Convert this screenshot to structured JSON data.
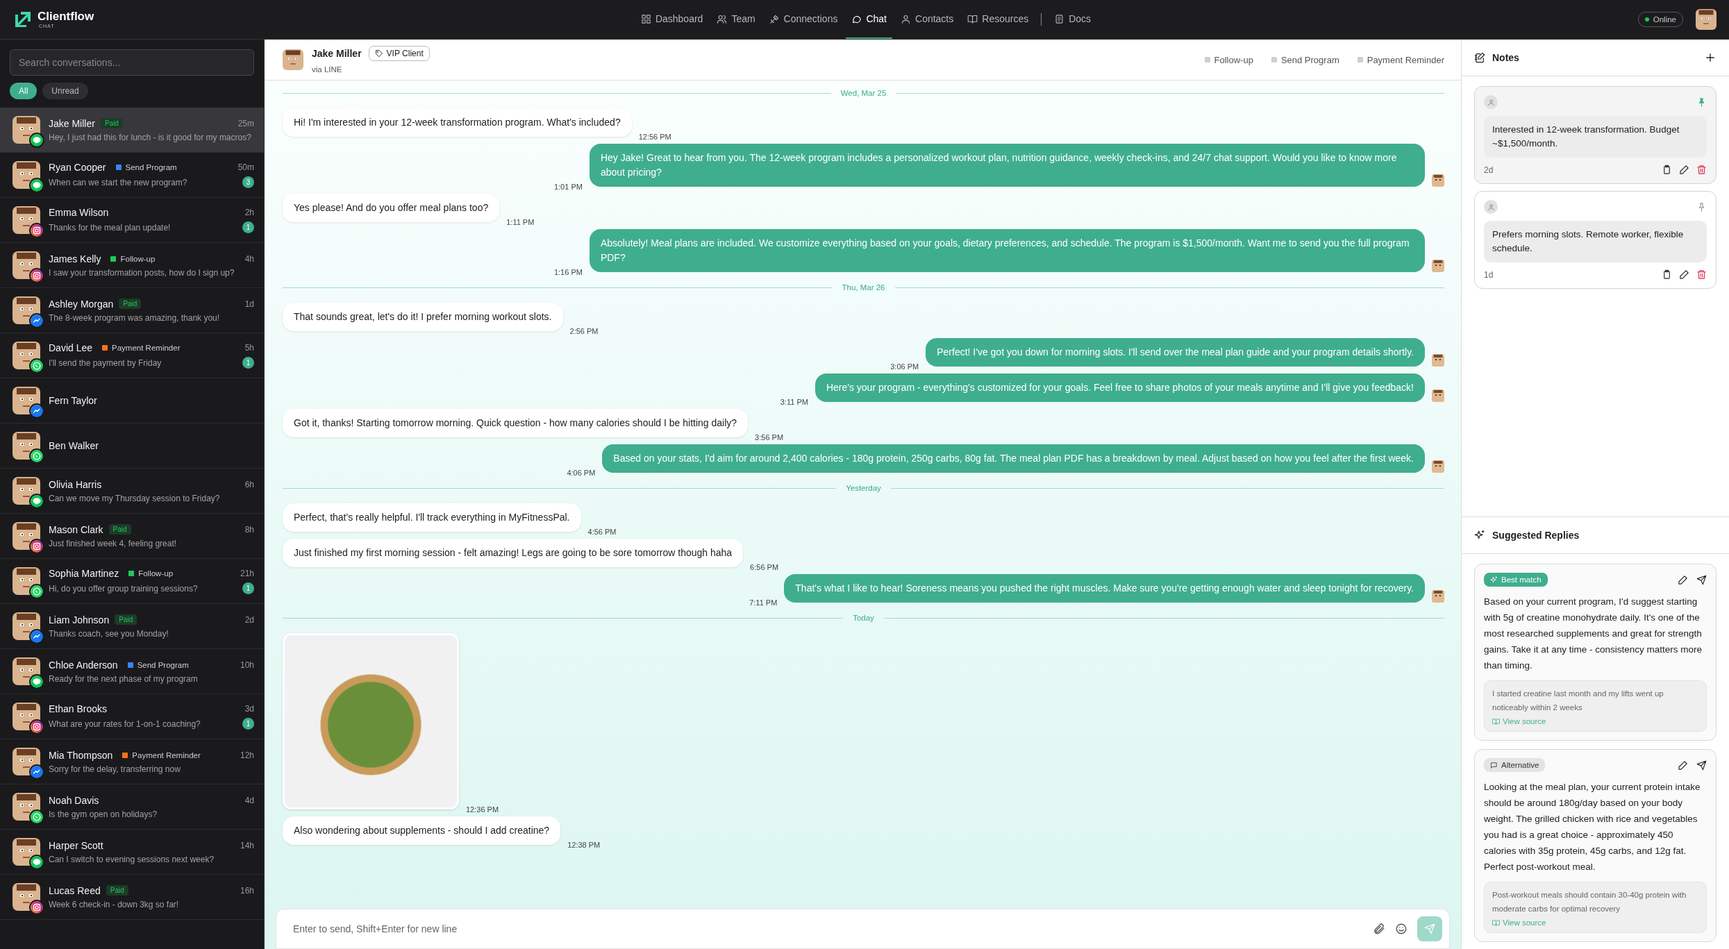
{
  "app": {
    "logo": "Clientflow",
    "logo_sub": "CHAT"
  },
  "nav": [
    {
      "label": "Dashboard",
      "selected": false,
      "separated": false
    },
    {
      "label": "Team",
      "selected": false,
      "separated": false
    },
    {
      "label": "Connections",
      "selected": false,
      "separated": false
    },
    {
      "label": "Chat",
      "selected": true,
      "separated": false
    },
    {
      "label": "Contacts",
      "selected": false,
      "separated": false
    },
    {
      "label": "Resources",
      "selected": false,
      "separated": false
    },
    {
      "label": "Docs",
      "selected": false,
      "separated": true
    }
  ],
  "status": {
    "label": "Online",
    "online": true
  },
  "sidebar": {
    "search": {
      "placeholder": "Search conversations..."
    },
    "filters": [
      {
        "label": "All",
        "selected": true
      },
      {
        "label": "Unread",
        "selected": false
      }
    ],
    "conversations": [
      {
        "name": "Jake Miller",
        "tag": {
          "kind": "paid",
          "text": "Paid"
        },
        "time": "25m",
        "preview": "Hey, I just had this for lunch - is it good for my macros?",
        "kind": "line",
        "selected": true
      },
      {
        "name": "Ryan Cooper",
        "tag": {
          "kind": "label",
          "text": "Send Program",
          "color": "#3b82f6"
        },
        "time": "50m",
        "preview": "When can we start the new program?",
        "unread": "3",
        "kind": "line",
        "selected": false
      },
      {
        "name": "Emma Wilson",
        "time": "2h",
        "preview": "Thanks for the meal plan update!",
        "unread": "1",
        "kind": "instagram",
        "selected": false
      },
      {
        "name": "James Kelly",
        "tag": {
          "kind": "label",
          "text": "Follow-up",
          "color": "#22c55e"
        },
        "time": "4h",
        "preview": "I saw your transformation posts, how do I sign up?",
        "kind": "instagram",
        "selected": false
      },
      {
        "name": "Ashley Morgan",
        "tag": {
          "kind": "paid",
          "text": "Paid"
        },
        "time": "1d",
        "preview": "The 8-week program was amazing, thank you!",
        "kind": "messenger",
        "selected": false
      },
      {
        "name": "David Lee",
        "tag": {
          "kind": "label",
          "text": "Payment Reminder",
          "color": "#f97316"
        },
        "time": "5h",
        "preview": "I'll send the payment by Friday",
        "unread": "1",
        "kind": "whatsapp",
        "selected": false
      },
      {
        "name": "Fern Taylor",
        "kind": "messenger",
        "selected": false
      },
      {
        "name": "Ben Walker",
        "kind": "whatsapp",
        "selected": false
      },
      {
        "name": "Olivia Harris",
        "time": "6h",
        "preview": "Can we move my Thursday session to Friday?",
        "kind": "line",
        "selected": false
      },
      {
        "name": "Mason Clark",
        "tag": {
          "kind": "paid",
          "text": "Paid"
        },
        "time": "8h",
        "preview": "Just finished week 4, feeling great!",
        "kind": "instagram",
        "selected": false
      },
      {
        "name": "Sophia Martinez",
        "tag": {
          "kind": "label",
          "text": "Follow-up",
          "color": "#22c55e"
        },
        "time": "21h",
        "preview": "Hi, do you offer group training sessions?",
        "unread": "1",
        "kind": "whatsapp",
        "selected": false
      },
      {
        "name": "Liam Johnson",
        "tag": {
          "kind": "paid",
          "text": "Paid"
        },
        "time": "2d",
        "preview": "Thanks coach, see you Monday!",
        "kind": "messenger",
        "selected": false
      },
      {
        "name": "Chloe Anderson",
        "tag": {
          "kind": "label",
          "text": "Send Program",
          "color": "#3b82f6"
        },
        "time": "10h",
        "preview": "Ready for the next phase of my program",
        "kind": "line",
        "selected": false
      },
      {
        "name": "Ethan Brooks",
        "time": "3d",
        "preview": "What are your rates for 1-on-1 coaching?",
        "unread": "1",
        "kind": "instagram",
        "selected": false
      },
      {
        "name": "Mia Thompson",
        "tag": {
          "kind": "label",
          "text": "Payment Reminder",
          "color": "#f97316"
        },
        "time": "12h",
        "preview": "Sorry for the delay, transferring now",
        "kind": "messenger",
        "selected": false
      },
      {
        "name": "Noah Davis",
        "time": "4d",
        "preview": "Is the gym open on holidays?",
        "kind": "whatsapp",
        "selected": false
      },
      {
        "name": "Harper Scott",
        "time": "14h",
        "preview": "Can I switch to evening sessions next week?",
        "kind": "line",
        "selected": false
      },
      {
        "name": "Lucas Reed",
        "tag": {
          "kind": "paid",
          "text": "Paid"
        },
        "time": "16h",
        "preview": "Week 6 check-in - down 3kg so far!",
        "kind": "instagram",
        "selected": false
      }
    ]
  },
  "chat": {
    "header": {
      "name": "Jake Miller",
      "tag": "VIP Client",
      "via": "via LINE",
      "quick_labels": [
        "Follow-up",
        "Send Program",
        "Payment Reminder"
      ]
    },
    "messages": [
      {
        "kind": "date",
        "text": "Wed, Mar 25"
      },
      {
        "kind": "in",
        "text": "Hi! I'm interested in your 12-week transformation program. What's included?",
        "time": "12:56 PM"
      },
      {
        "kind": "out",
        "text": "Hey Jake! Great to hear from you. The 12-week program includes a personalized workout plan, nutrition guidance, weekly check-ins, and 24/7 chat support. Would you like to know more about pricing?",
        "time": "1:01 PM"
      },
      {
        "kind": "in",
        "text": "Yes please! And do you offer meal plans too?",
        "time": "1:11 PM"
      },
      {
        "kind": "out",
        "text": "Absolutely! Meal plans are included. We customize everything based on your goals, dietary preferences, and schedule. The program is $1,500/month. Want me to send you the full program PDF?",
        "time": "1:16 PM"
      },
      {
        "kind": "date",
        "text": "Thu, Mar 26"
      },
      {
        "kind": "in",
        "text": "That sounds great, let's do it! I prefer morning workout slots.",
        "time": "2:56 PM"
      },
      {
        "kind": "out",
        "text": "Perfect! I've got you down for morning slots. I'll send over the meal plan guide and your program details shortly.",
        "time": "3:06 PM"
      },
      {
        "kind": "out",
        "text": "Here's your program - everything's customized for your goals. Feel free to share photos of your meals anytime and I'll give you feedback!",
        "time": "3:11 PM"
      },
      {
        "kind": "in",
        "text": "Got it, thanks! Starting tomorrow morning. Quick question - how many calories should I be hitting daily?",
        "time": "3:56 PM"
      },
      {
        "kind": "out",
        "text": "Based on your stats, I'd aim for around 2,400 calories - 180g protein, 250g carbs, 80g fat. The meal plan PDF has a breakdown by meal. Adjust based on how you feel after the first week.",
        "time": "4:06 PM"
      },
      {
        "kind": "date",
        "text": "Yesterday"
      },
      {
        "kind": "in",
        "text": "Perfect, that's really helpful. I'll track everything in MyFitnessPal.",
        "time": "4:56 PM"
      },
      {
        "kind": "in",
        "text": "Just finished my first morning session - felt amazing! Legs are going to be sore tomorrow though haha",
        "time": "6:56 PM"
      },
      {
        "kind": "out",
        "text": "That's what I like to hear! Soreness means you pushed the right muscles. Make sure you're getting enough water and sleep tonight for recovery.",
        "time": "7:11 PM"
      },
      {
        "kind": "date",
        "text": "Today"
      },
      {
        "kind": "image",
        "time": "12:36 PM"
      },
      {
        "kind": "in",
        "text": "Also wondering about supplements - should I add creatine?",
        "time": "12:38 PM"
      }
    ],
    "composer": {
      "placeholder": "Enter to send, Shift+Enter for new line"
    }
  },
  "notes": {
    "title": "Notes",
    "items": [
      {
        "text": "Interested in 12-week transformation. Budget ~$1,500/month.",
        "age": "2d",
        "pinned": true
      },
      {
        "text": "Prefers morning slots. Remote worker, flexible schedule.",
        "age": "1d",
        "pinned": false
      }
    ]
  },
  "suggestions": {
    "title": "Suggested Replies",
    "items": [
      {
        "kind": "best",
        "badge": "Best match",
        "text": "Based on your current program, I'd suggest starting with 5g of creatine monohydrate daily. It's one of the most researched supplements and great for strength gains. Take it at any time - consistency matters more than timing.",
        "source": "I started creatine last month and my lifts went up noticeably within 2 weeks",
        "link": "View source"
      },
      {
        "kind": "alternative",
        "badge": "Alternative",
        "text": "Looking at the meal plan, your current protein intake should be around 180g/day based on your body weight. The grilled chicken with rice and vegetables you had is a great choice - approximately 450 calories with 35g protein, 45g carbs, and 12g fat. Perfect post-workout meal.",
        "source": "Post-workout meals should contain 30-40g protein with moderate carbs for optimal recovery",
        "link": "View source"
      }
    ]
  }
}
